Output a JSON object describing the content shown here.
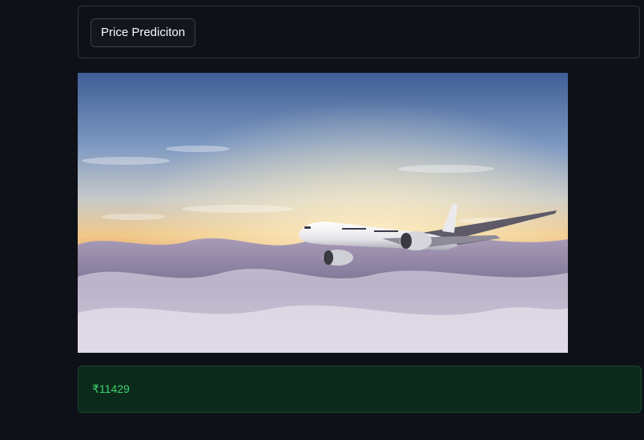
{
  "form": {
    "predict_button_label": "Price Prediciton"
  },
  "hero_image": {
    "subject": "airplane-above-clouds"
  },
  "result": {
    "value": "₹11429",
    "color": "#3dd56d",
    "background": "#0c2a1b"
  },
  "theme": {
    "background": "#0e1117",
    "border": "#31333b",
    "text": "#fafafa"
  }
}
